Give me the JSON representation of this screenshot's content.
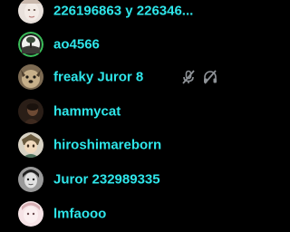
{
  "participants": [
    {
      "name": "226196863 y 226346...",
      "avatar": "avatar-pale-face"
    },
    {
      "name": "ao4566",
      "avatar": "avatar-tree-green-ring",
      "accent": "#3bbf5a"
    },
    {
      "name": "freaky Juror 8",
      "avatar": "avatar-dog",
      "muted": true,
      "deafened": true
    },
    {
      "name": "hammycat",
      "avatar": "avatar-dark-figure"
    },
    {
      "name": "hiroshimareborn",
      "avatar": "avatar-anime-character"
    },
    {
      "name": "Juror 232989335",
      "avatar": "avatar-grayscale-face"
    },
    {
      "name": "lmfaooo",
      "avatar": "avatar-pink-face"
    }
  ],
  "icons": {
    "mute": "mic-off-icon",
    "deafen": "headphones-off-icon"
  },
  "colors": {
    "background": "#000000",
    "name_text": "#2ee6ea",
    "icon": "#8e9297"
  }
}
